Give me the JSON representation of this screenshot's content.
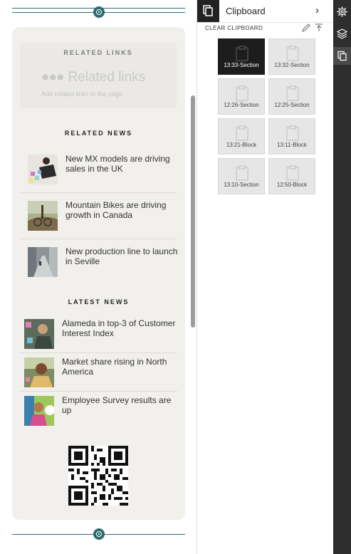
{
  "canvas": {
    "related_links": {
      "title": "RELATED LINKS",
      "placeholder": "Related links",
      "hint": "Add related links to the page"
    },
    "related_news": {
      "title": "RELATED NEWS",
      "items": [
        {
          "text": "New MX models are driving sales in the UK"
        },
        {
          "text": "Mountain Bikes are driving growth in Canada"
        },
        {
          "text": "New production line to launch in Seville"
        }
      ]
    },
    "latest_news": {
      "title": "LATEST NEWS",
      "items": [
        {
          "text": "Alameda in top-3 of Customer Interest Index"
        },
        {
          "text": "Market share rising in North America"
        },
        {
          "text": "Employee Survey results are up"
        }
      ]
    }
  },
  "clipboard": {
    "title": "Clipboard",
    "clear_label": "CLEAR CLIPBOARD",
    "items": [
      {
        "label": "13:33-Section",
        "active": true
      },
      {
        "label": "13:32-Section",
        "active": false
      },
      {
        "label": "12:26-Section",
        "active": false
      },
      {
        "label": "12:25-Section",
        "active": false
      },
      {
        "label": "13:21-Block",
        "active": false
      },
      {
        "label": "13:11-Block",
        "active": false
      },
      {
        "label": "13:10-Section",
        "active": false
      },
      {
        "label": "12:50-Block",
        "active": false
      }
    ]
  },
  "toolbar": {
    "buttons": [
      {
        "icon": "gear-icon",
        "active": false
      },
      {
        "icon": "layers-icon",
        "active": false
      },
      {
        "icon": "clipboard-copy-icon",
        "active": true
      }
    ]
  }
}
